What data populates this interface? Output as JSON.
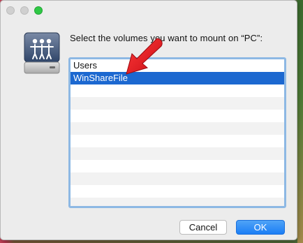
{
  "window": {
    "traffic_lights": [
      {
        "name": "close",
        "color": "#d0d0d0"
      },
      {
        "name": "minimize",
        "color": "#d0d0d0"
      },
      {
        "name": "zoom",
        "color": "#2fc845"
      }
    ]
  },
  "dialog": {
    "icon": "shared-server-drive-icon",
    "prompt": "Select the volumes you want to mount on “PC”:",
    "volumes": [
      {
        "label": "Users",
        "selected": false
      },
      {
        "label": "WinShareFile",
        "selected": true
      }
    ],
    "annotation": "red-arrow-icon",
    "buttons": {
      "cancel": "Cancel",
      "ok": "OK"
    }
  },
  "colors": {
    "selection": "#1c68d0",
    "focus_ring": "#8db8e4",
    "primary_button": "#1b7ef5",
    "annotation_arrow": "#e8121b"
  }
}
